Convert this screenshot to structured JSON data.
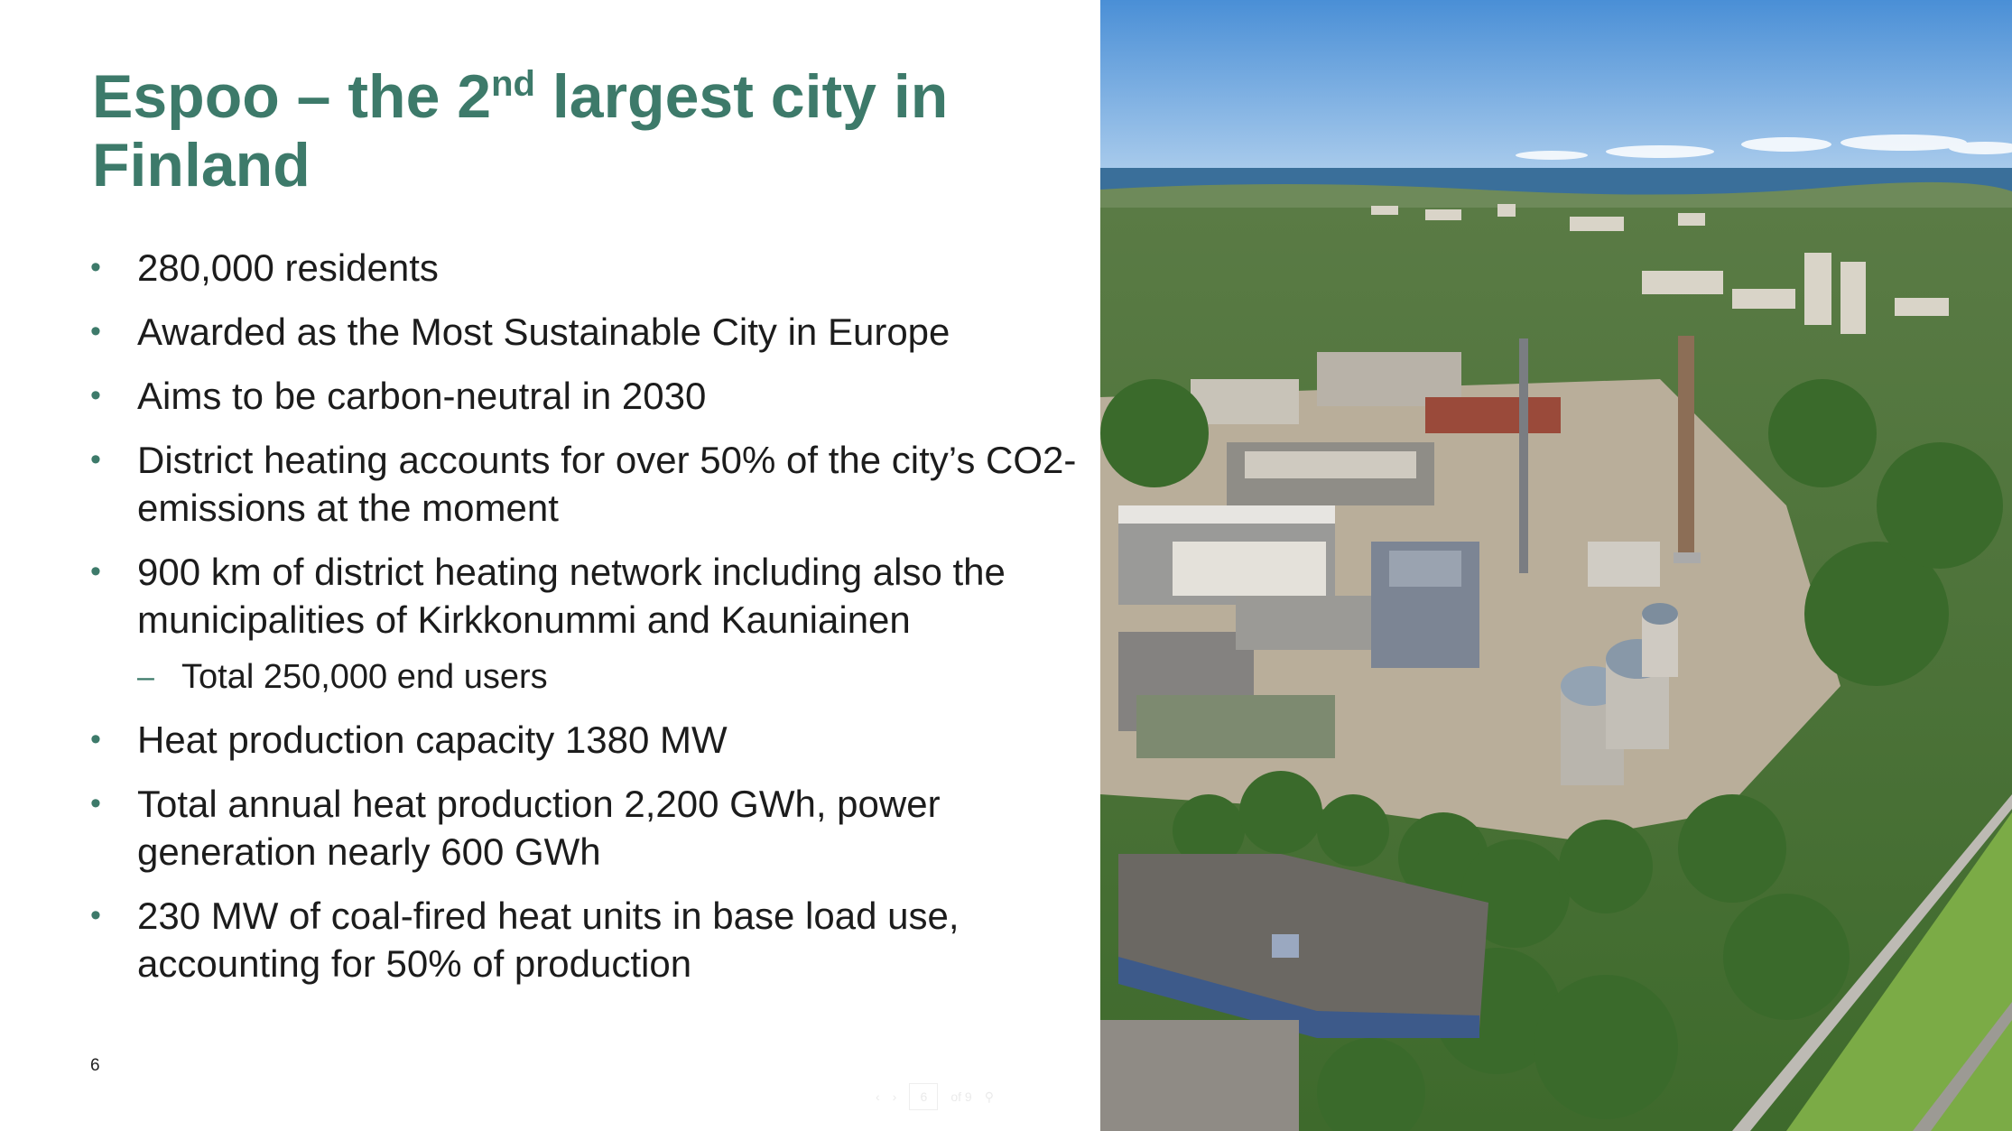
{
  "slide": {
    "title_prefix": "Espoo – the 2",
    "title_sup": "nd",
    "title_suffix": " largest city in Finland",
    "bullets": [
      {
        "level": 1,
        "text": "280,000 residents"
      },
      {
        "level": 1,
        "text": "Awarded as the Most Sustainable City in Europe"
      },
      {
        "level": 1,
        "text": "Aims to be carbon-neutral in 2030"
      },
      {
        "level": 1,
        "text": "District heating accounts for over 50% of the city’s CO2-emissions at the moment"
      },
      {
        "level": 1,
        "text": "900 km of district heating network including also the municipalities of Kirkkonummi and Kauniainen"
      },
      {
        "level": 2,
        "text": "Total 250,000 end users"
      },
      {
        "level": 1,
        "text": "Heat production capacity 1380 MW"
      },
      {
        "level": 1,
        "text": "Total annual heat production 2,200 GWh, power generation nearly 600 GWh"
      },
      {
        "level": 1,
        "text": "230 MW of coal-fired heat units in base load use, accounting for 50% of production"
      }
    ],
    "page_number": "6",
    "bullet_glyph": "•",
    "dash_glyph": "–",
    "accent_color": "#3d7a6a"
  },
  "viewer": {
    "prev_icon": "chevron-left-icon",
    "next_icon": "chevron-right-icon",
    "page_value": "6",
    "of_label": "of 9",
    "zoom_icon": "zoom-icon"
  },
  "photo": {
    "subject": "aerial-photo-power-plant"
  }
}
